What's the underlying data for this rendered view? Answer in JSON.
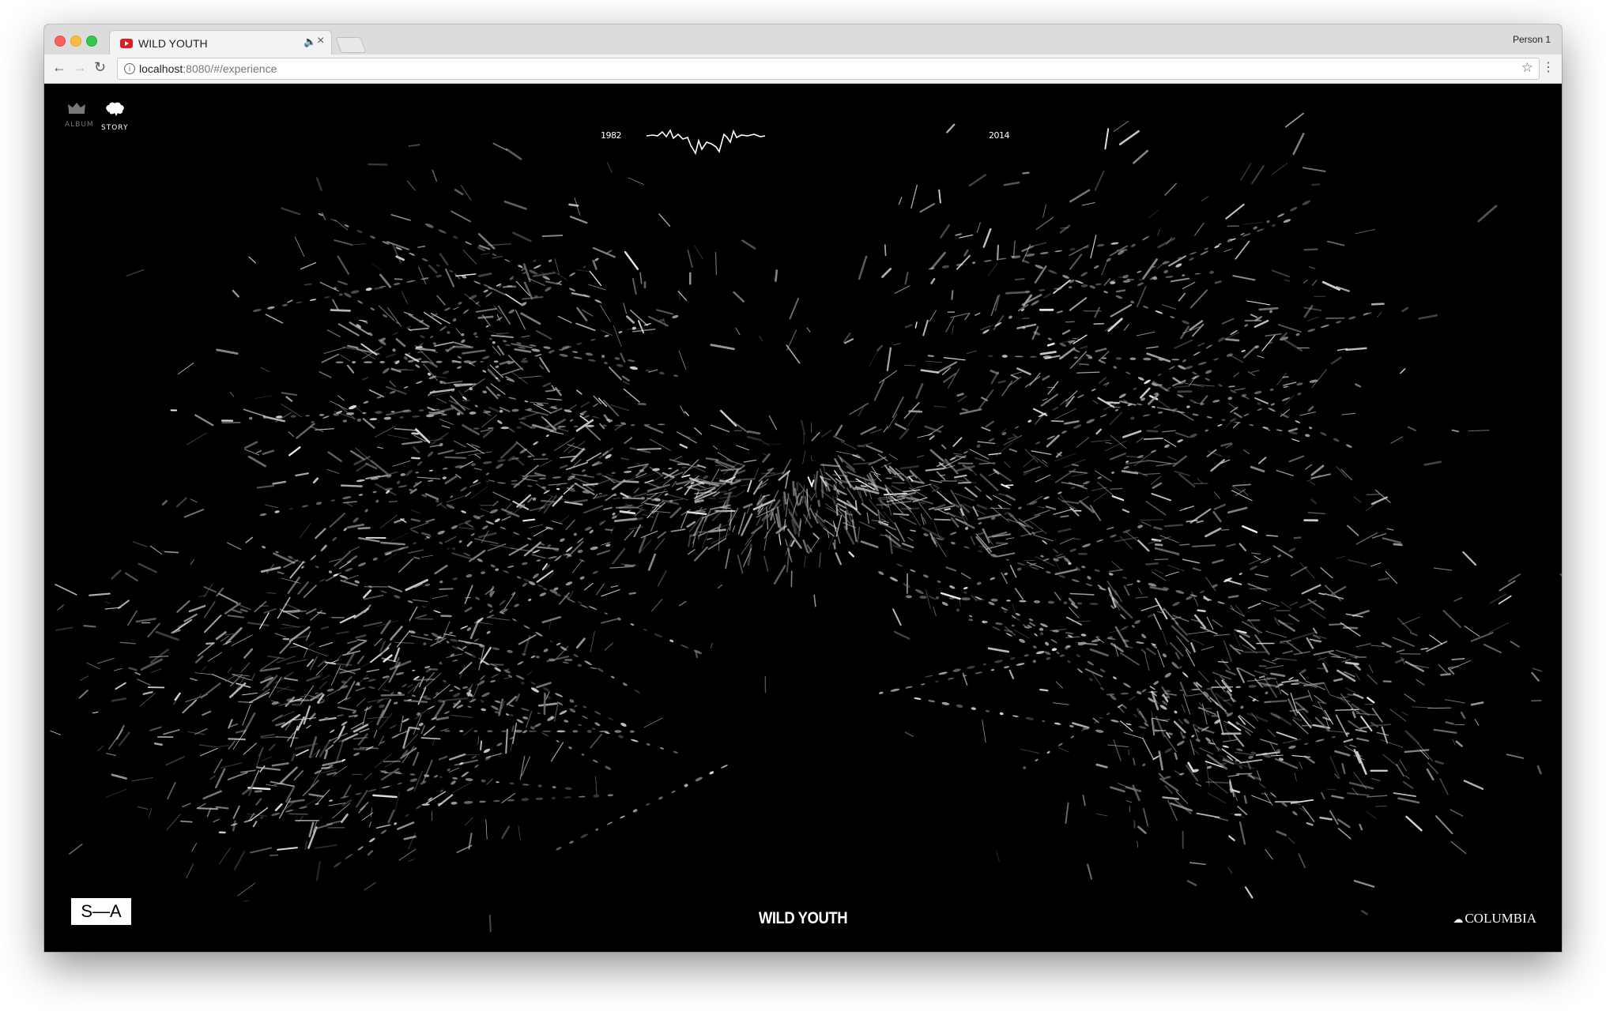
{
  "browser": {
    "tab_title": "WILD YOUTH",
    "profile_name": "Person 1",
    "url_host": "localhost",
    "url_path": ":8080/#/experience"
  },
  "app": {
    "nav": [
      {
        "label": "ALBUM",
        "icon": "crown-icon"
      },
      {
        "label": "STORY",
        "icon": "brain-icon"
      }
    ],
    "timeline": {
      "start_year": "1982",
      "end_year": "2014"
    },
    "logo_left": "S—A",
    "title": "WILD YOUTH",
    "label_name": "COLUMBIA"
  }
}
